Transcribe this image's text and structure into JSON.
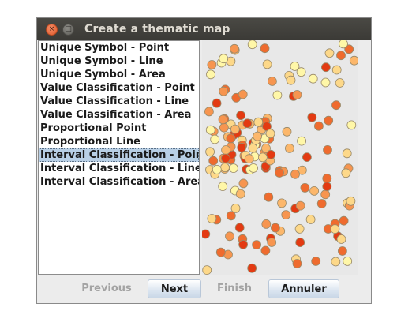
{
  "window": {
    "title": "Create a thematic map",
    "close_glyph": "×",
    "max_glyph": "□"
  },
  "list": {
    "items": [
      "Unique Symbol - Point",
      "Unique Symbol - Line",
      "Unique Symbol - Area",
      "Value Classification - Point",
      "Value Classification - Line",
      "Value Classification - Area",
      "Proportional Point",
      "Proportional Line",
      "Interval Classification - Point",
      "Interval Classification - Line",
      "Interval Classification - Area"
    ],
    "selected_index": 8
  },
  "preview": {
    "colors": [
      "#fff7a8",
      "#fdd889",
      "#fcb76b",
      "#f7954f",
      "#ef6b2e",
      "#e33a12"
    ],
    "stroke": "#9a8a6a"
  },
  "buttons": {
    "previous": "Previous",
    "next": "Next",
    "finish": "Finish",
    "cancel": "Annuler"
  }
}
